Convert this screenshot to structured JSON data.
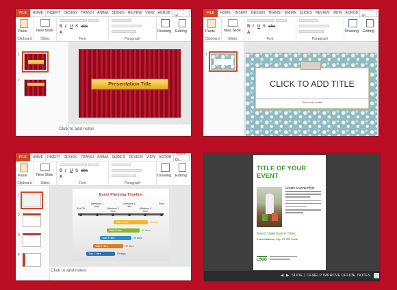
{
  "ribbon": {
    "tabs": [
      "FILE",
      "HOME",
      "INSERT",
      "DESIGN",
      "TRANSI",
      "ANIMA",
      "SLIDES",
      "REVIEW",
      "VIEW",
      "ACROB"
    ],
    "tabs_p3": [
      "FILE",
      "HOME",
      "INSERT",
      "DESIGN",
      "TRANSI",
      "ANIMA",
      "SLIDE S",
      "REVIEW",
      "VIEW",
      "ACROB"
    ],
    "user": "Tiffany Gr...",
    "paste": "Paste",
    "new_slide": "New Slide",
    "drawing": "Drawing",
    "editing": "Editing",
    "groups": {
      "clipboard": "Clipboard",
      "slides": "Slides",
      "font": "Font",
      "paragraph": "Paragraph"
    },
    "font_buttons": [
      "B",
      "I",
      "U",
      "S",
      "abc",
      "A"
    ],
    "para_prefix": "A"
  },
  "pane1": {
    "slide_numbers": [
      "1",
      "2"
    ],
    "slide_title": "Presentation Title",
    "notes": "Click to add notes"
  },
  "pane2": {
    "slide_numbers": [
      "1"
    ],
    "slide_title": "CLICK TO ADD TITLE",
    "subtitle": "Click to add subtitle"
  },
  "pane3": {
    "slide_numbers": [
      "1",
      "2",
      "3",
      "4"
    ],
    "timeline_title": "Event Planning Timeline",
    "milestones": [
      {
        "label": "Kick Off"
      },
      {
        "label": "Milestone 1 Here"
      },
      {
        "label": "Milestone 2 Here"
      },
      {
        "label": "Milestone 3 Here"
      },
      {
        "label": "Milestone 4 Here"
      },
      {
        "label": "Done"
      }
    ],
    "tasks": [
      {
        "label": "Task 1 Here",
        "days": "31 days",
        "color": "#2f6db5"
      },
      {
        "label": "Task 2 Here",
        "days": "45 days",
        "color": "#e07a20"
      },
      {
        "label": "Task 3 Here",
        "days": "45 days",
        "color": "#2f8fc8"
      },
      {
        "label": "Task 4 Here",
        "days": "51 days",
        "color": "#8ab82c"
      },
      {
        "label": "Task 5 Here",
        "days": "36 days",
        "color": "#f2b71c"
      }
    ],
    "notes": "Click to add notes"
  },
  "pane4": {
    "title": "TITLE OF YOUR EVENT",
    "subhead": "Create a Great Flyer",
    "event_date": "Event Date Event Time",
    "address": "Event Address, City, ST ZIP Code",
    "logo": "LOGO",
    "status_slide": "SLIDE 1 OF 1",
    "status_help": "HELP IMPROVE OFFICE",
    "status_notes": "NOTES"
  },
  "colors": {
    "background": "#b90e24",
    "accent": "#d24726",
    "green": "#3f9a2a"
  }
}
